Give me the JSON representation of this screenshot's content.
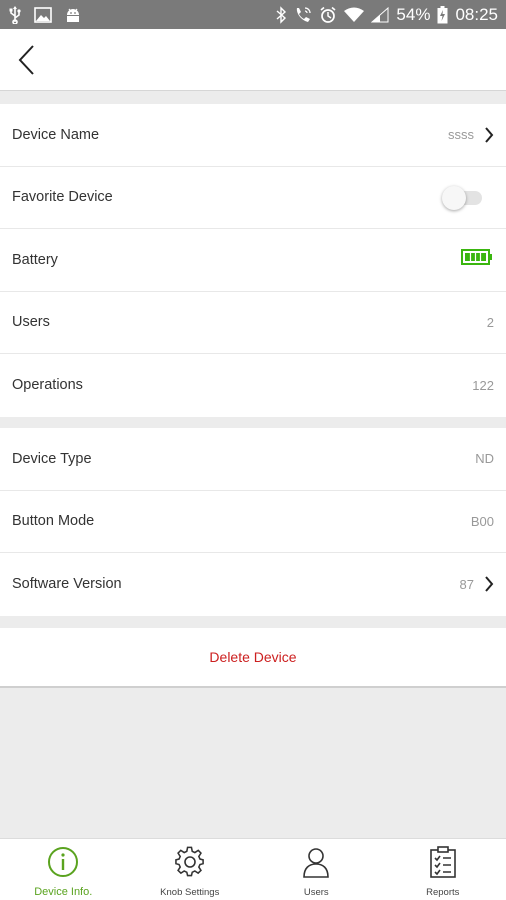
{
  "status_bar": {
    "battery_percent": "54%",
    "time": "08:25",
    "icons": [
      "usb-icon",
      "image-icon",
      "android-icon",
      "bluetooth-icon",
      "wifi-call-icon",
      "alarm-icon",
      "wifi-icon",
      "signal-icon",
      "battery-charging-icon"
    ]
  },
  "header": {
    "back_icon": "chevron-left-icon"
  },
  "device_section": {
    "device_name": {
      "label": "Device Name",
      "value": "ssss"
    },
    "favorite": {
      "label": "Favorite Device",
      "enabled": false
    },
    "battery": {
      "label": "Battery",
      "level": 1.0,
      "color": "#3ab60f"
    },
    "users": {
      "label": "Users",
      "value": "2"
    },
    "operations": {
      "label": "Operations",
      "value": "122"
    }
  },
  "info_section": {
    "device_type": {
      "label": "Device Type",
      "value": "ND"
    },
    "button_mode": {
      "label": "Button Mode",
      "value": "B00"
    },
    "software_version": {
      "label": "Software Version",
      "value": "87"
    }
  },
  "actions": {
    "delete_label": "Delete Device",
    "delete_color": "#cc1f1f"
  },
  "tabs": [
    {
      "label": "Device Info.",
      "icon": "info-circle-icon",
      "active": true
    },
    {
      "label": "Knob Settings",
      "icon": "gear-icon",
      "active": false
    },
    {
      "label": "Users",
      "icon": "user-icon",
      "active": false
    },
    {
      "label": "Reports",
      "icon": "clipboard-checklist-icon",
      "active": false
    }
  ],
  "colors": {
    "accent": "#5aa31f",
    "status_bar": "#7a7a7a"
  }
}
